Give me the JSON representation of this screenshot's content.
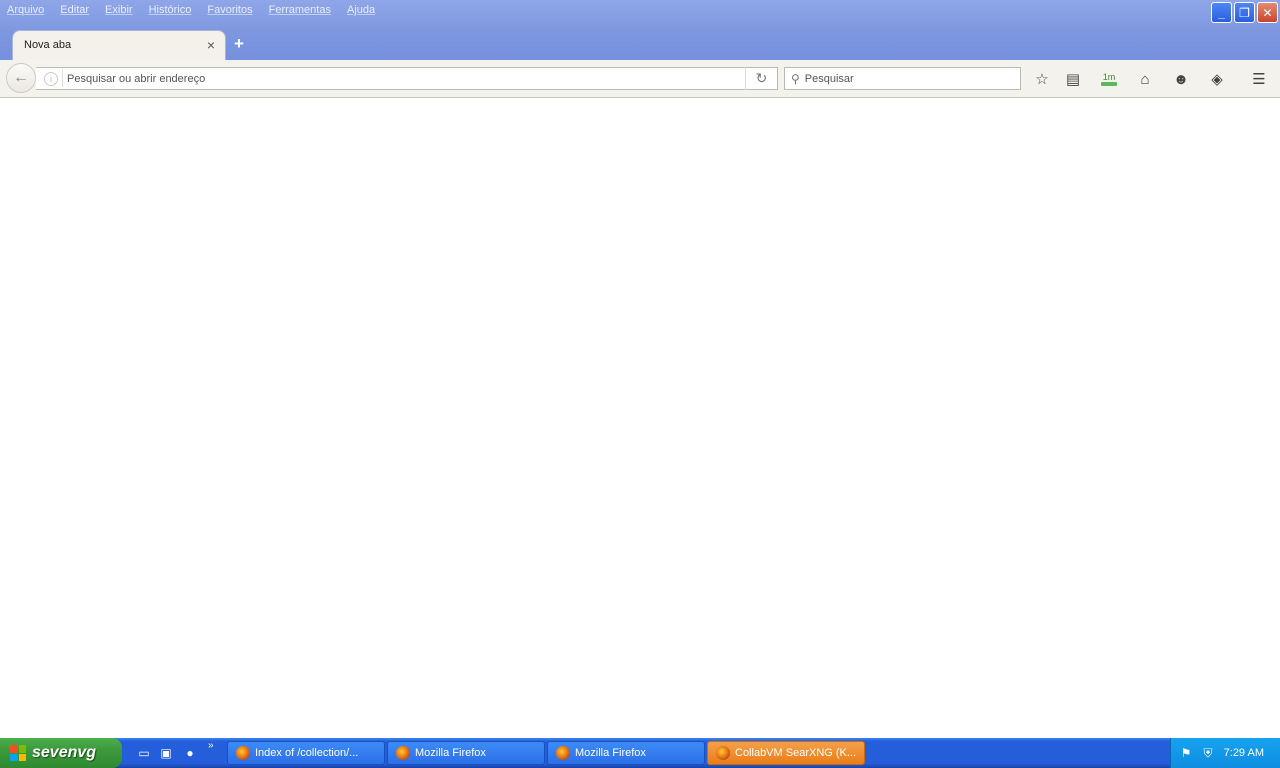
{
  "menubar": {
    "items": [
      "Arquivo",
      "Editar",
      "Exibir",
      "Histórico",
      "Favoritos",
      "Ferramentas",
      "Ajuda"
    ]
  },
  "tabs": [
    {
      "title": "Nova aba"
    }
  ],
  "navbar": {
    "url_placeholder": "Pesquisar ou abrir endereço",
    "search_placeholder": "Pesquisar",
    "extension_badge": "1m"
  },
  "taskbar": {
    "start_label": "sevenvg",
    "quick_launch_more": "»",
    "tasks": [
      {
        "label": "Index of /collection/...",
        "active": false
      },
      {
        "label": "Mozilla Firefox",
        "active": false
      },
      {
        "label": "Mozilla Firefox",
        "active": false
      },
      {
        "label": "CollabVM SearXNG (K...",
        "active": true
      }
    ],
    "clock": "7:29 AM"
  },
  "colors": {
    "titlebar": "#7d97e0",
    "taskbar": "#245edb",
    "start": "#3c9a3c",
    "active_task": "#ea7d16",
    "tray": "#0f8de0"
  }
}
